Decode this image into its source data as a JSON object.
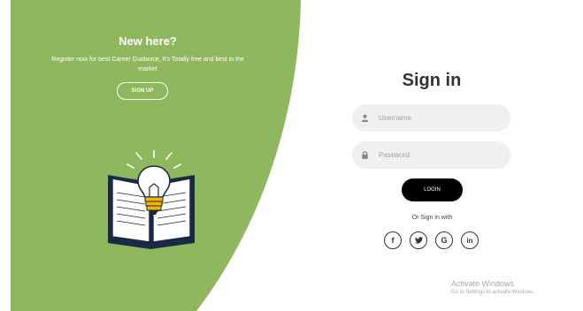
{
  "colors": {
    "accent": "#8fb85e",
    "dark": "#000000",
    "field_bg": "#f0f0f0"
  },
  "left": {
    "title": "New here?",
    "text": "Register now for best Career Guidance, It's Totally free and best in the market",
    "signup_label": "SIGN UP",
    "illustration_icon": "book-lightbulb-icon"
  },
  "form": {
    "title": "Sign in",
    "username_placeholder": "Username",
    "password_placeholder": "Password",
    "login_label": "LOGIN",
    "or_text": "Or Sign in with",
    "social": [
      {
        "icon": "facebook-icon",
        "glyph": "f"
      },
      {
        "icon": "twitter-icon",
        "glyph": "🐦"
      },
      {
        "icon": "google-icon",
        "glyph": "G"
      },
      {
        "icon": "linkedin-icon",
        "glyph": "in"
      }
    ]
  },
  "watermark": {
    "title": "Activate Windows",
    "subtitle": "Go to Settings to activate Windows."
  }
}
